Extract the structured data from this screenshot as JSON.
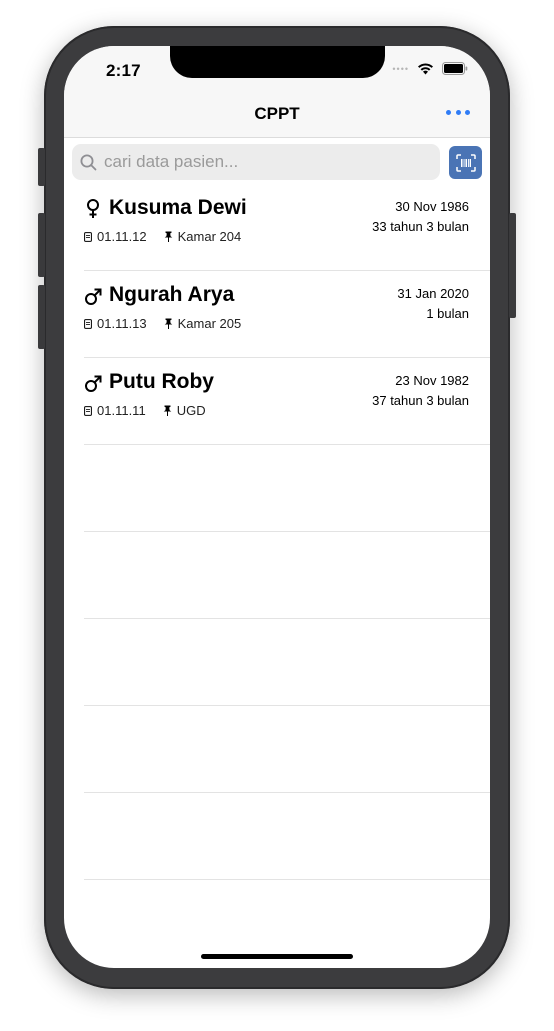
{
  "status": {
    "time": "2:17"
  },
  "navbar": {
    "title": "CPPT"
  },
  "search": {
    "placeholder": "cari data pasien...",
    "value": ""
  },
  "patients": [
    {
      "gender": "female",
      "name": "Kusuma Dewi",
      "record_no": "01.11.12",
      "room": "Kamar 204",
      "dob": "30 Nov 1986",
      "age": "33 tahun 3 bulan"
    },
    {
      "gender": "male",
      "name": "Ngurah Arya",
      "record_no": "01.11.13",
      "room": "Kamar 205",
      "dob": "31 Jan 2020",
      "age": "1 bulan"
    },
    {
      "gender": "male",
      "name": "Putu Roby",
      "record_no": "01.11.11",
      "room": "UGD",
      "dob": "23 Nov 1982",
      "age": "37 tahun 3 bulan"
    }
  ],
  "colors": {
    "accent": "#2f7cf6",
    "scan_button": "#4a74b5"
  }
}
